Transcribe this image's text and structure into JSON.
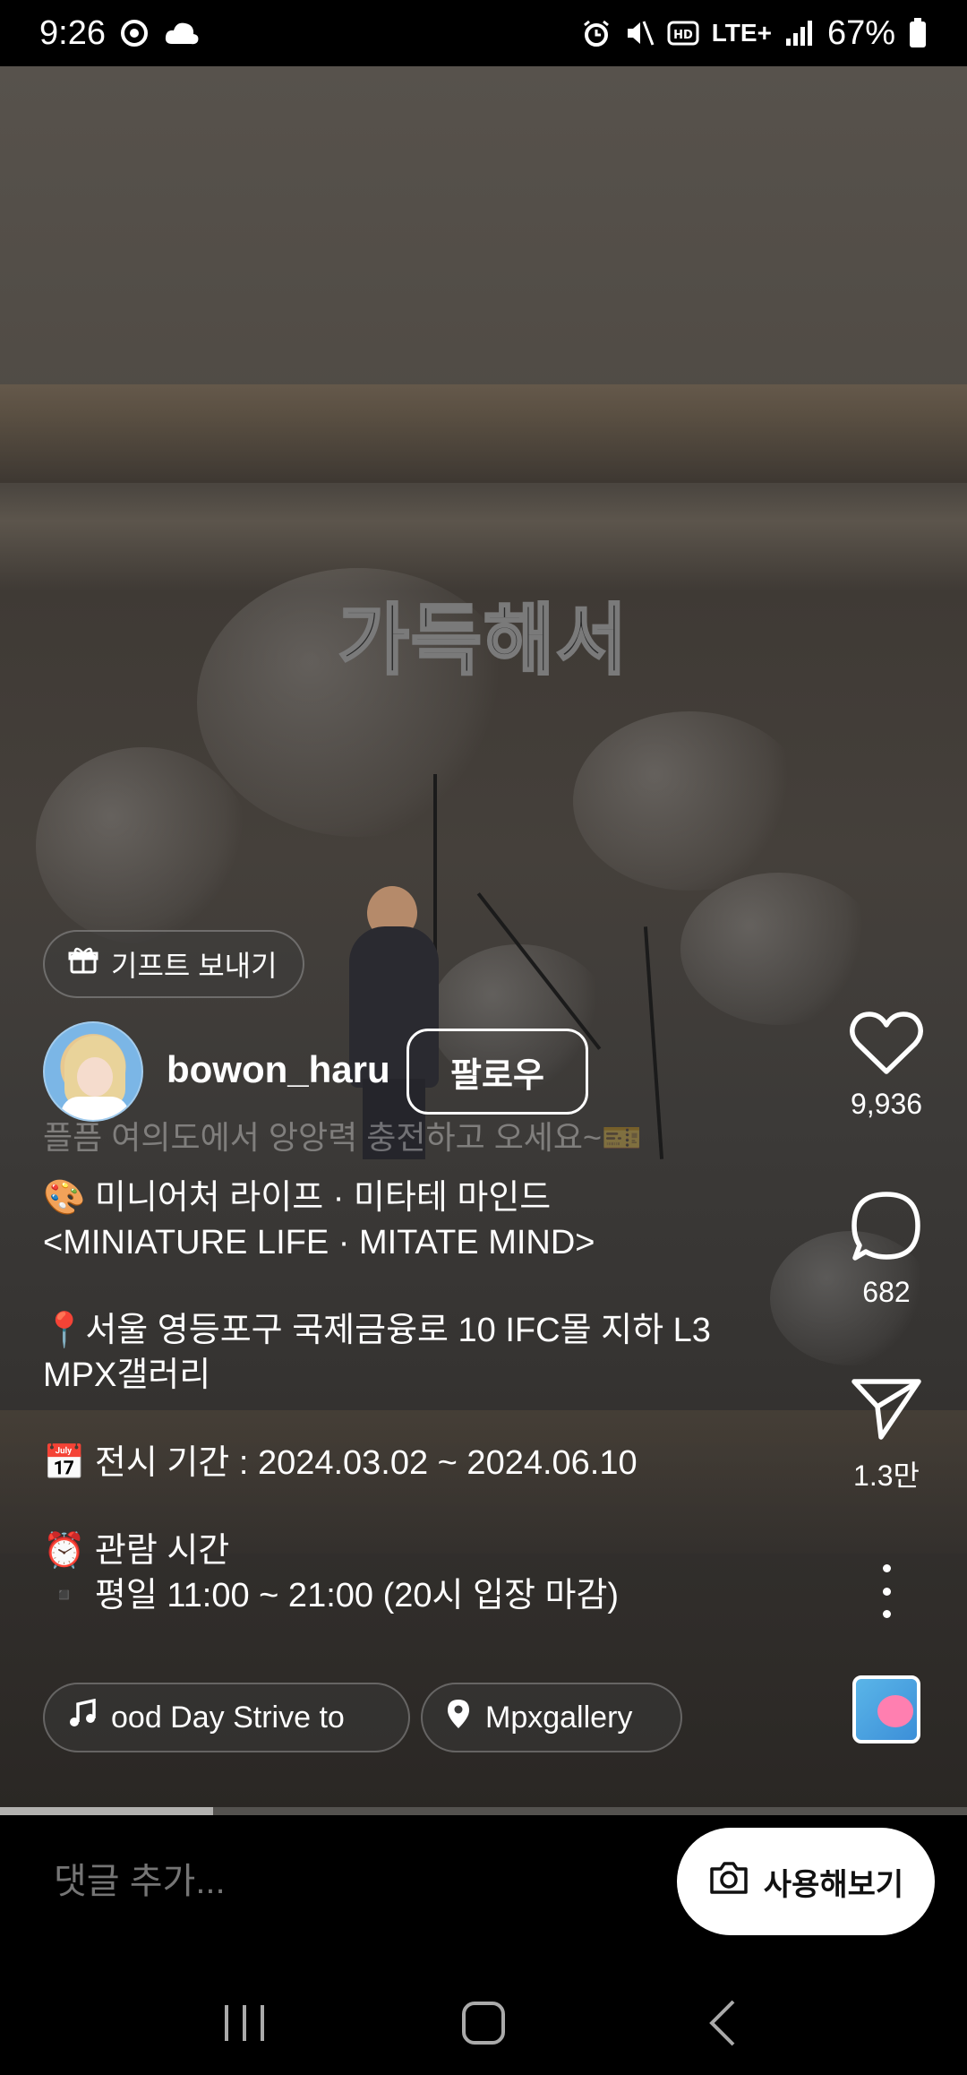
{
  "status_bar": {
    "time": "9:26",
    "network": "LTE+",
    "battery": "67%",
    "icons": [
      "alarm-icon",
      "mute-icon",
      "hd-icon",
      "signal-icon",
      "battery-icon"
    ]
  },
  "video": {
    "caption_overlay": "가득해서"
  },
  "gift": {
    "label": "기프트 보내기"
  },
  "author": {
    "username": "bowon_haru",
    "follow_label": "팔로우"
  },
  "description": {
    "faded_line": "플픔 여의도에서 앙앙력 충전하고 오세요~🎫",
    "blocks": [
      "🎨 미니어처 라이프 · 미타테 마인드\n<MINIATURE LIFE · MITATE MIND>",
      "📍서울 영등포구 국제금융로 10 IFC몰 지하 L3\nMPX갤러리",
      "📅 전시 기간 : 2024.03.02 ~ 2024.06.10",
      "⏰ 관람 시간\n▪️ 평일  11:00 ~ 21:00 (20시 입장 마감)"
    ]
  },
  "chips": {
    "music": "ood Day    Strive to",
    "location": "Mpxgallery"
  },
  "actions": {
    "likes": "9,936",
    "comments": "682",
    "shares": "1.3만"
  },
  "playback": {
    "progress": 0.22
  },
  "comment_bar": {
    "placeholder": "댓글 추가...",
    "try_label": "사용해보기"
  },
  "colors": {
    "background": "#000000",
    "text": "#ffffff",
    "button_bg": "#ffffff"
  }
}
